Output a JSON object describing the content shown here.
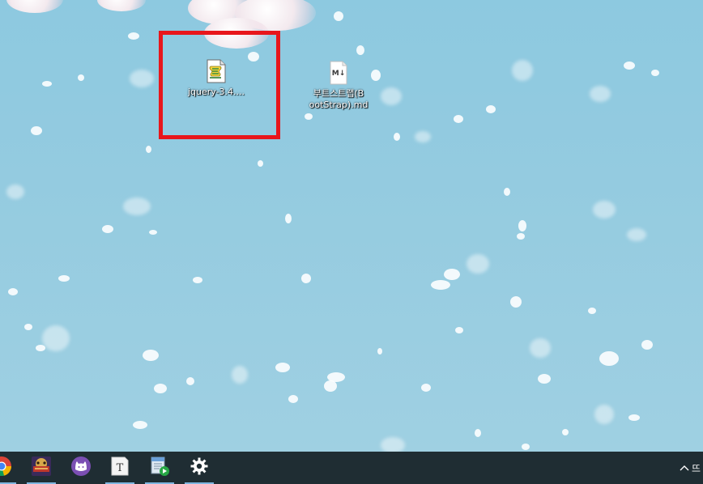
{
  "desktop": {
    "icons": [
      {
        "label": "jquery-3.4....",
        "icon": "script-file-icon"
      },
      {
        "label": "부트스트랩(BootStrap).md",
        "label_line1": "부트스트랩(B",
        "label_line2": "ootStrap).md",
        "icon": "markdown-file-icon",
        "badge": "M↓"
      }
    ],
    "highlight_color": "#e8161b"
  },
  "taskbar": {
    "apps": [
      {
        "name": "chrome",
        "icon": "chrome-icon"
      },
      {
        "name": "game",
        "icon": "game-app-icon"
      },
      {
        "name": "cat",
        "icon": "cat-app-icon"
      },
      {
        "name": "typora",
        "icon": "typora-icon",
        "glyph": "T"
      },
      {
        "name": "media",
        "icon": "media-player-icon"
      },
      {
        "name": "settings",
        "icon": "gear-icon",
        "glyph": "⚙"
      }
    ],
    "tray": {
      "chevron": "^",
      "ime": "뜨"
    },
    "accent": "#7fb6e0",
    "background": "#1f2d33"
  }
}
